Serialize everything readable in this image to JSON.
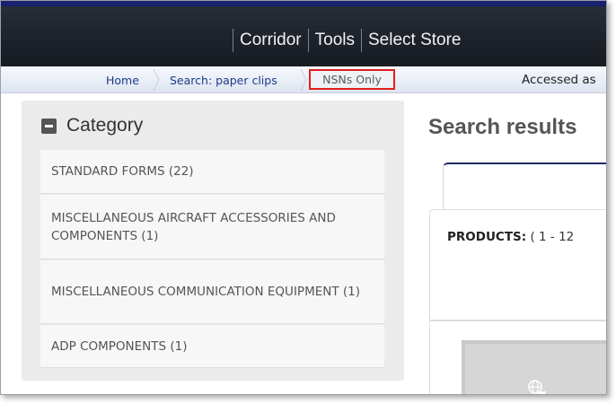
{
  "nav": {
    "items": [
      "Corridor",
      "Tools",
      "Select Store"
    ]
  },
  "breadcrumb": {
    "home": "Home",
    "search": "Search: paper clips",
    "filter": "NSNs Only",
    "accessed": "Accessed as"
  },
  "category": {
    "title": "Category",
    "items": [
      {
        "label": "STANDARD FORMS (22)"
      },
      {
        "label": "MISCELLANEOUS AIRCRAFT ACCESSORIES AND COMPONENTS (1)"
      },
      {
        "label": "MISCELLANEOUS COMMUNICATION EQUIPMENT (1)"
      },
      {
        "label": "ADP COMPONENTS (1)"
      }
    ]
  },
  "results": {
    "title": "Search results",
    "products_label": "PRODUCTS:",
    "products_range": "( 1 - 12"
  },
  "colors": {
    "filter_highlight": "#e0201c",
    "nav_accent": "#18226e",
    "link": "#1a3a8a"
  },
  "icons": {
    "collapse": "minus-square-icon",
    "thumbnail": "globe-cart-icon"
  }
}
